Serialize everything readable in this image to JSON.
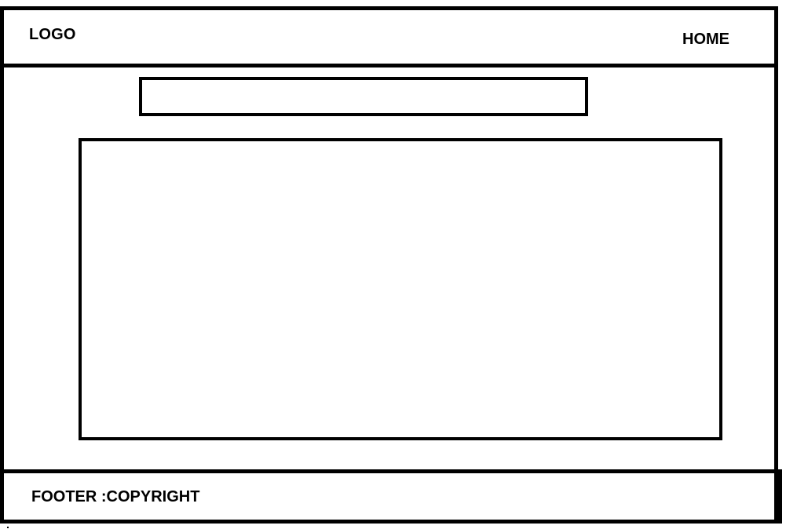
{
  "header": {
    "logo_label": "LOGO",
    "home_label": "HOME"
  },
  "main": {
    "search": {
      "value": "",
      "placeholder": ""
    }
  },
  "footer": {
    "copyright_label": "FOOTER :COPYRIGHT"
  }
}
